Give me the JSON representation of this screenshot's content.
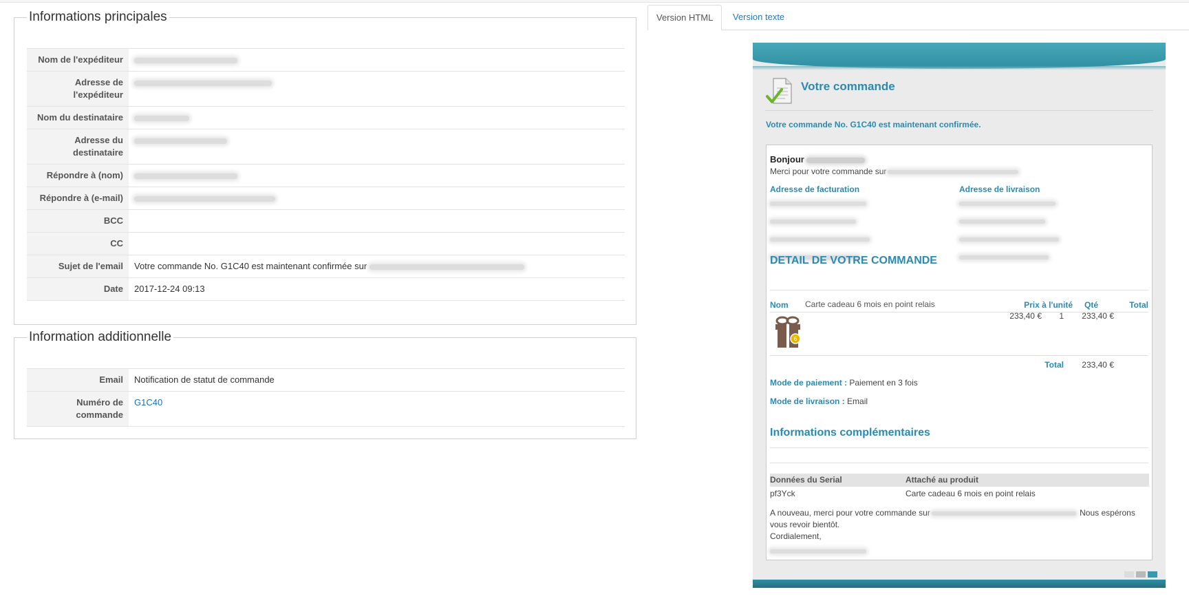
{
  "main_info": {
    "legend": "Informations principales",
    "rows": [
      {
        "label": "Nom de l'expéditeur",
        "value": ""
      },
      {
        "label": "Adresse de l'expéditeur",
        "value": ""
      },
      {
        "label": "Nom du destinataire",
        "value": ""
      },
      {
        "label": "Adresse du destinataire",
        "value": ""
      },
      {
        "label": "Répondre à (nom)",
        "value": ""
      },
      {
        "label": "Répondre à (e-mail)",
        "value": ""
      },
      {
        "label": "BCC",
        "value": ""
      },
      {
        "label": "CC",
        "value": ""
      },
      {
        "label": "Sujet de l'email",
        "value": "Votre commande No. G1C40 est maintenant confirmée sur"
      },
      {
        "label": "Date",
        "value": "2017-12-24 09:13"
      }
    ]
  },
  "extra_info": {
    "legend": "Information additionnelle",
    "rows": [
      {
        "label": "Email",
        "value": "Notification de statut de commande"
      },
      {
        "label": "Numéro de commande",
        "value": "G1C40"
      }
    ]
  },
  "tabs": [
    {
      "label": "Version HTML",
      "active": true
    },
    {
      "label": "Version texte",
      "active": false
    }
  ],
  "preview": {
    "title": "Votre commande",
    "confirmation": "Votre commande No. G1C40 est maintenant confirmée.",
    "greeting": "Bonjour",
    "thanks_prefix": "Merci pour votre commande sur",
    "billing_title": "Adresse de facturation",
    "shipping_title": "Adresse de livraison",
    "detail_title": "DETAIL DE VOTRE COMMANDE",
    "columns": {
      "name": "Nom",
      "unit_price": "Prix à l'unité",
      "qty": "Qté",
      "total": "Total"
    },
    "item": {
      "name": "Carte cadeau 6 mois en point relais",
      "unit_price": "233,40 €",
      "qty": "1",
      "total": "233,40 €"
    },
    "total_label": "Total",
    "total_value": "233,40 €",
    "payment_label": "Mode de paiement :",
    "payment_value": "Paiement en 3 fois",
    "shipping_label": "Mode de livraison :",
    "shipping_value": "Email",
    "extra_title": "Informations complémentaires",
    "serial_cols": {
      "data": "Données du Serial",
      "product": "Attaché au produit"
    },
    "serial_row": {
      "data": "pf3Yck",
      "product": "Carte cadeau 6 mois en point relais"
    },
    "closing_prefix": "A nouveau, merci pour votre commande sur",
    "closing_suffix": "Nous espérons",
    "closing_line2": "vous revoir bientôt.",
    "closing_line3": "Cordialement,"
  },
  "colors": {
    "accent": "#2a8ab0",
    "header_teal": "#3b98aa",
    "link": "#1f6fb2"
  }
}
